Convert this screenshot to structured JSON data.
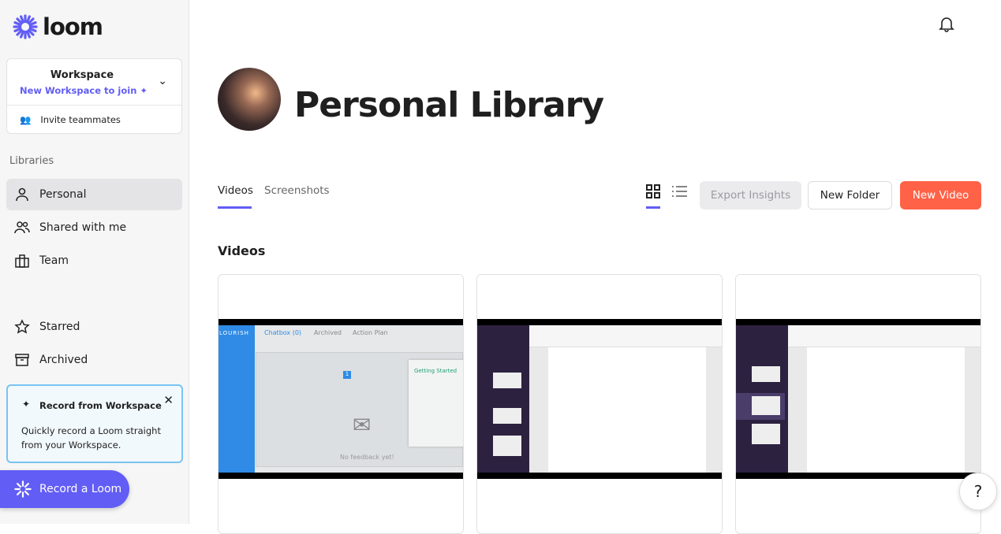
{
  "brand": {
    "name": "loom",
    "color": "#625df5"
  },
  "workspace": {
    "title": "Workspace",
    "subtitle": "New Workspace to join",
    "invite": "Invite teammates"
  },
  "sidebar": {
    "libraries_heading": "Libraries",
    "items": [
      {
        "label": "Personal",
        "icon": "person-icon",
        "active": true
      },
      {
        "label": "Shared with me",
        "icon": "people-icon"
      },
      {
        "label": "Team",
        "icon": "building-icon"
      },
      {
        "label": "Starred",
        "icon": "star-icon"
      },
      {
        "label": "Archived",
        "icon": "archive-icon"
      }
    ]
  },
  "tip": {
    "title": "Record from Workspace",
    "body": "Quickly record a Loom straight from your Workspace."
  },
  "record_button": "Record a Loom",
  "page": {
    "title": "Personal Library"
  },
  "tabs": [
    {
      "label": "Videos",
      "active": true
    },
    {
      "label": "Screenshots"
    }
  ],
  "view": {
    "mode": "grid"
  },
  "actions": {
    "export": "Export Insights",
    "new_folder": "New Folder",
    "new_video": "New Video",
    "new_video_color": "#ff6247"
  },
  "section": "Videos",
  "thumb1": {
    "brand": "LOURISH",
    "tabs": [
      "Chatbox (0)",
      "Archived",
      "Action Plan"
    ],
    "panel": "Getting Started",
    "empty": "No feedback yet!",
    "page": "1"
  },
  "help": "?"
}
